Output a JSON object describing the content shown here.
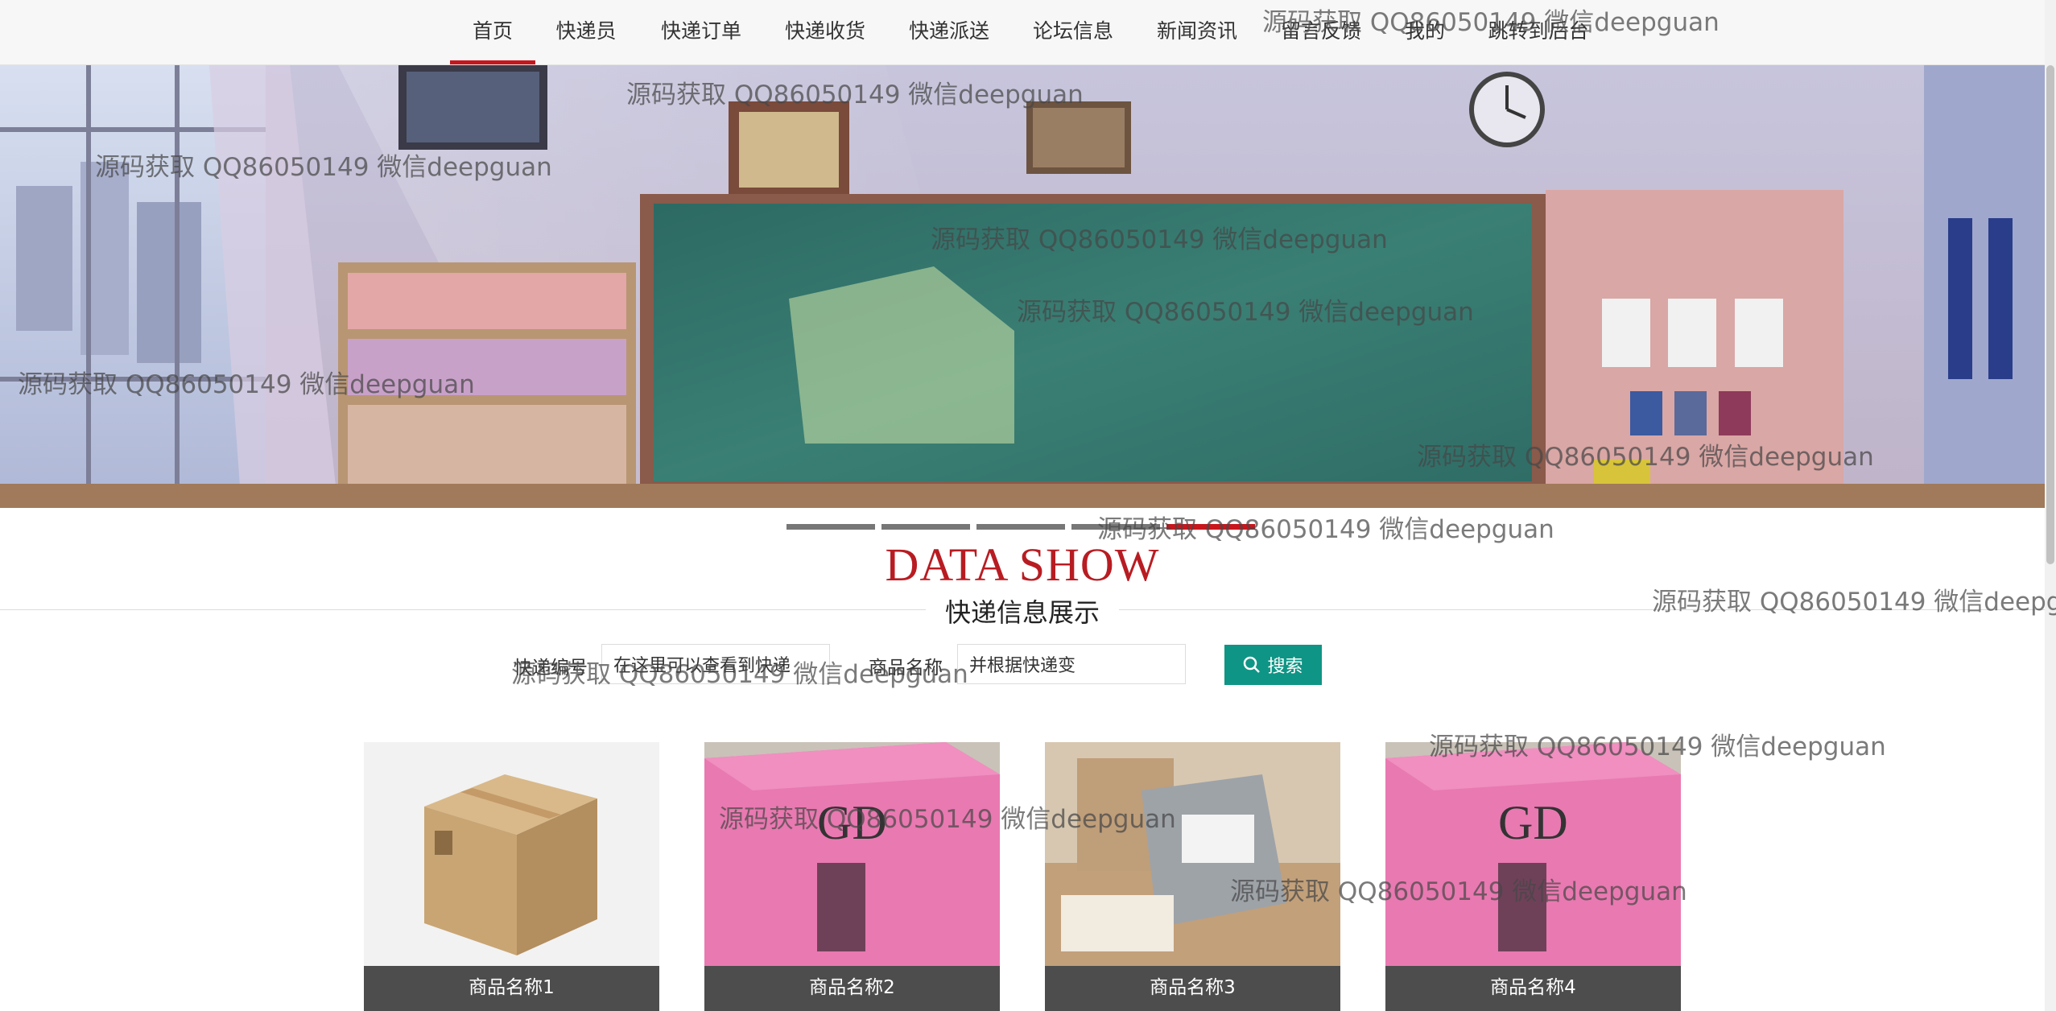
{
  "nav": {
    "items": [
      "首页",
      "快递员",
      "快递订单",
      "快递收货",
      "快递派送",
      "论坛信息",
      "新闻资讯",
      "留言反馈",
      "我的",
      "跳转到后台"
    ],
    "active_index": 0
  },
  "section": {
    "title_en": "DATA SHOW",
    "title_cn": "快递信息展示"
  },
  "search": {
    "field1_label": "快递编号",
    "field1_value": "在这里可以查看到快递",
    "field2_label": "商品名称",
    "field2_value": "并根据快递变",
    "button_label": "搜索"
  },
  "carousel": {
    "slide_count": 5,
    "active_index": 4
  },
  "products": [
    {
      "name": "商品名称1"
    },
    {
      "name": "商品名称2"
    },
    {
      "name": "商品名称3"
    },
    {
      "name": "商品名称4"
    }
  ],
  "watermark": {
    "text": "源码获取 QQ86050149 微信deepguan"
  },
  "colors": {
    "accent_red": "#c8161d",
    "button_teal": "#0f9585",
    "caption_gray": "#4d4d4d"
  }
}
